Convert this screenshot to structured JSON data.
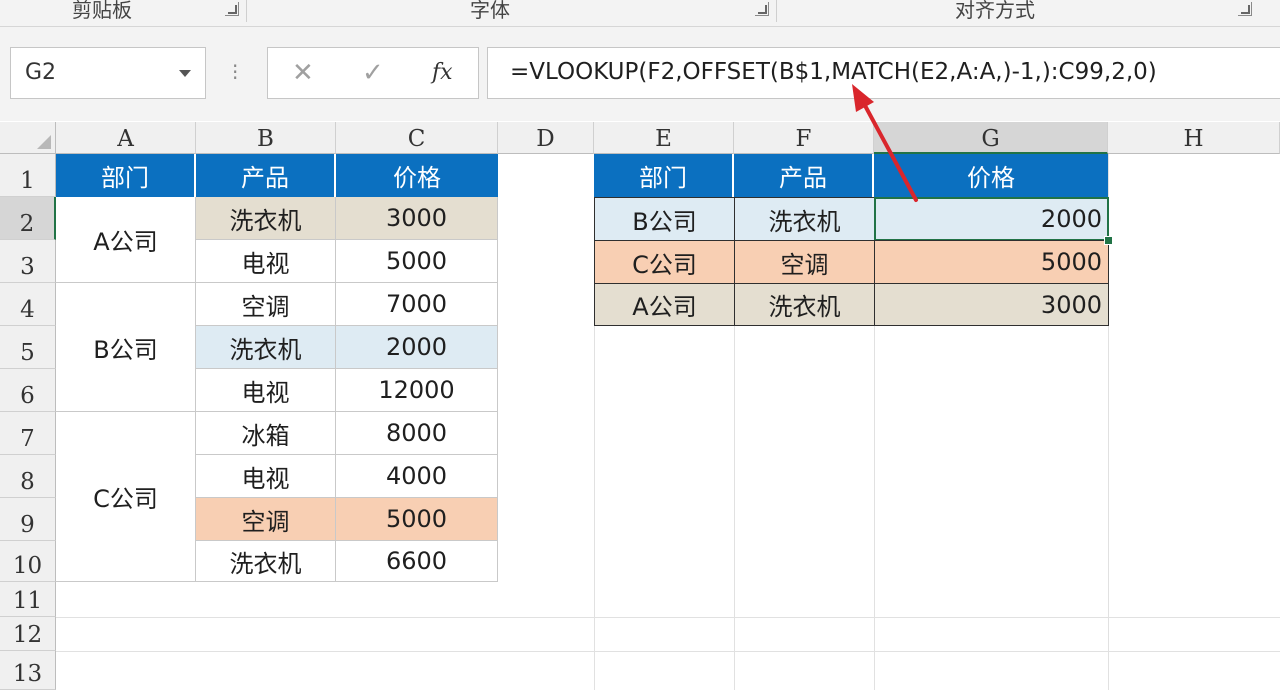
{
  "ribbon": {
    "groups": [
      {
        "label": "剪贴板"
      },
      {
        "label": "字体"
      },
      {
        "label": "对齐方式"
      }
    ]
  },
  "name_box": {
    "value": "G2"
  },
  "formula_bar": {
    "cancel_icon": "✕",
    "enter_icon": "✓",
    "fx_label": "fx",
    "formula": "=VLOOKUP(F2,OFFSET(B$1,MATCH(E2,A:A,)-1,):C99,2,0)"
  },
  "columns": [
    "A",
    "B",
    "C",
    "D",
    "E",
    "F",
    "G",
    "H"
  ],
  "rows": [
    "1",
    "2",
    "3",
    "4",
    "5",
    "6",
    "7",
    "8",
    "9",
    "10",
    "11",
    "12",
    "13"
  ],
  "table1": {
    "headers": [
      "部门",
      "产品",
      "价格"
    ],
    "departments": [
      "A公司",
      "B公司",
      "C公司"
    ],
    "rows": [
      {
        "product": "洗衣机",
        "price": "3000"
      },
      {
        "product": "电视",
        "price": "5000"
      },
      {
        "product": "空调",
        "price": "7000"
      },
      {
        "product": "洗衣机",
        "price": "2000"
      },
      {
        "product": "电视",
        "price": "12000"
      },
      {
        "product": "冰箱",
        "price": "8000"
      },
      {
        "product": "电视",
        "price": "4000"
      },
      {
        "product": "空调",
        "price": "5000"
      },
      {
        "product": "洗衣机",
        "price": "6600"
      }
    ]
  },
  "table2": {
    "headers": [
      "部门",
      "产品",
      "价格"
    ],
    "rows": [
      {
        "dept": "B公司",
        "product": "洗衣机",
        "price": "2000"
      },
      {
        "dept": "C公司",
        "product": "空调",
        "price": "5000"
      },
      {
        "dept": "A公司",
        "product": "洗衣机",
        "price": "3000"
      }
    ]
  },
  "colors": {
    "header_blue": "#0b70c0",
    "tan": "#e4ded0",
    "light_blue": "#deebf3",
    "peach": "#f8cfb3",
    "excel_green": "#217346",
    "arrow_red": "#d9262c"
  }
}
